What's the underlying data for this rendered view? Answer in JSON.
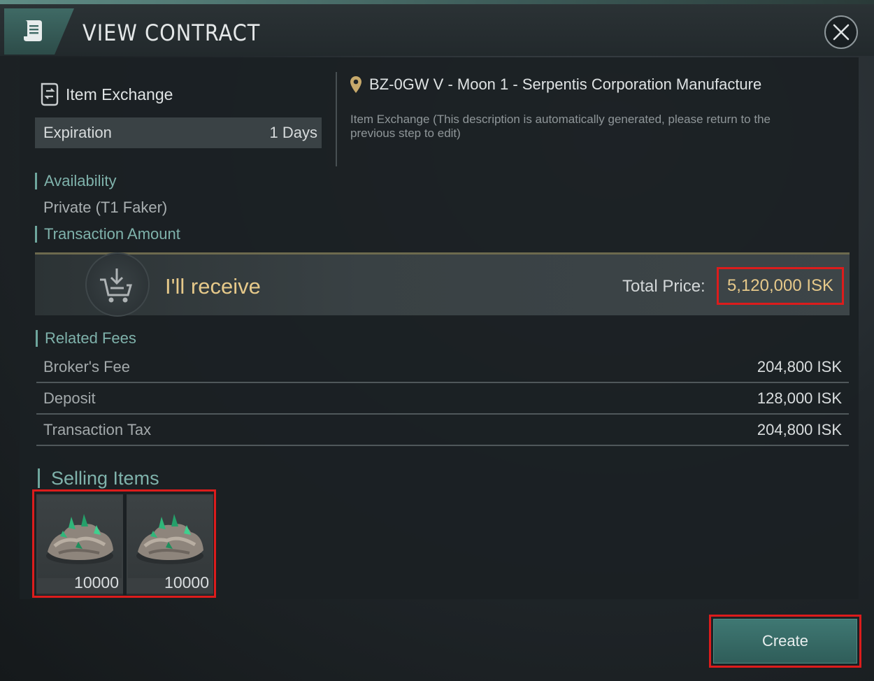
{
  "header": {
    "title": "VIEW CONTRACT",
    "icon": "scroll-icon",
    "close_icon": "close-icon"
  },
  "contract": {
    "type_label": "Item Exchange",
    "type_icon": "item-exchange-icon",
    "expiration_label": "Expiration",
    "expiration_value": "1 Days",
    "location_icon": "location-pin-icon",
    "location": "BZ-0GW V - Moon 1 - Serpentis Corporation Manufacture",
    "description_line1": "Item Exchange  (This description is automatically generated, please return to the",
    "description_line2": "previous step to edit)"
  },
  "availability": {
    "section_label": "Availability",
    "value": "Private (T1 Faker)"
  },
  "transaction": {
    "section_label": "Transaction Amount",
    "receive_label": "I'll receive",
    "receive_icon": "cart-download-icon",
    "total_label": "Total Price:",
    "total_value": "5,120,000 ISK"
  },
  "fees": {
    "section_label": "Related Fees",
    "rows": [
      {
        "name": "Broker's Fee",
        "value": "204,800 ISK"
      },
      {
        "name": "Deposit",
        "value": "128,000 ISK"
      },
      {
        "name": "Transaction Tax",
        "value": "204,800 ISK"
      }
    ]
  },
  "selling": {
    "section_label": "Selling Items",
    "items": [
      {
        "icon": "ore-item-icon",
        "quantity": "10000"
      },
      {
        "icon": "ore-item-icon",
        "quantity": "10000"
      }
    ]
  },
  "actions": {
    "create_label": "Create"
  },
  "colors": {
    "accent_teal": "#7fb2ab",
    "gold": "#e6c98a",
    "highlight_red": "#dc1c1c"
  }
}
